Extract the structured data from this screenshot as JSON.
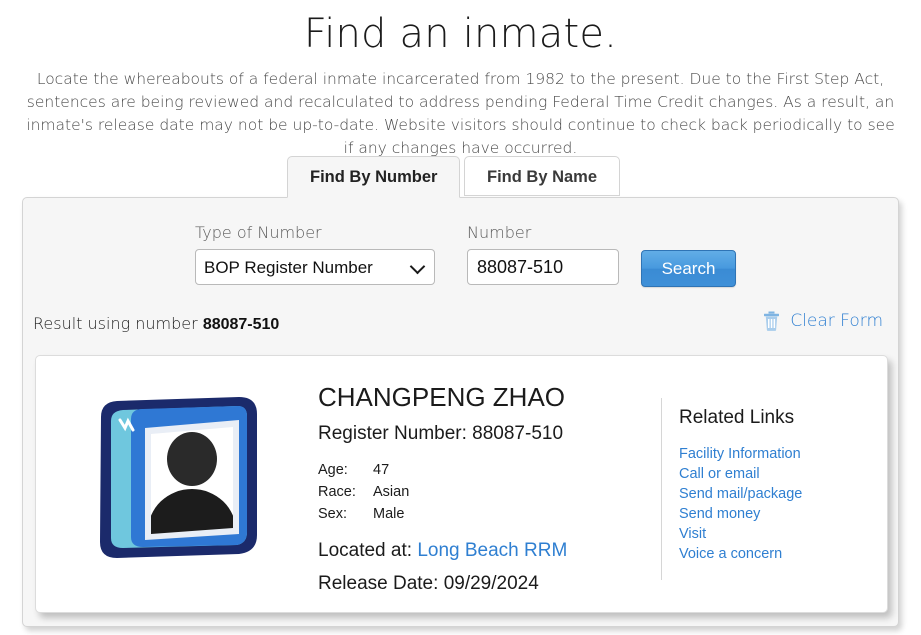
{
  "header": {
    "title": "Find an inmate.",
    "intro": "Locate the whereabouts of a federal inmate incarcerated from 1982 to the present. Due to the First Step Act, sentences are being reviewed and recalculated to address pending Federal Time Credit changes. As a result, an inmate's release date may not be up-to-date. Website visitors should continue to check back periodically to see if any changes have occurred."
  },
  "tabs": [
    {
      "label": "Find By Number",
      "active": true
    },
    {
      "label": "Find By Name",
      "active": false
    }
  ],
  "form": {
    "type_label": "Type of Number",
    "type_value": "BOP Register Number",
    "type_options": [
      "BOP Register Number"
    ],
    "number_label": "Number",
    "number_value": "88087-510",
    "number_placeholder": "",
    "search_label": "Search",
    "search_button_color": "#3f90d8"
  },
  "result_bar": {
    "prefix": "Result using number ",
    "number": "88087-510",
    "clear_form_label": "Clear Form",
    "clear_form_color": "#2f7fd1"
  },
  "result": {
    "name": "CHANGPENG ZHAO",
    "register_line": "Register Number: 88087-510",
    "attributes": [
      {
        "key": "Age:",
        "value": "47"
      },
      {
        "key": "Race:",
        "value": "Asian"
      },
      {
        "key": "Sex:",
        "value": "Male"
      }
    ],
    "located_label": "Located at:",
    "located_value": "Long Beach RRM",
    "release_label": "Release Date:",
    "release_value": "09/29/2024",
    "photo_icon": "person-photo-frame-icon"
  },
  "related": {
    "title": "Related Links",
    "links": [
      "Facility Information",
      "Call or email",
      "Send mail/package",
      "Send money",
      "Visit",
      "Voice a concern"
    ]
  }
}
